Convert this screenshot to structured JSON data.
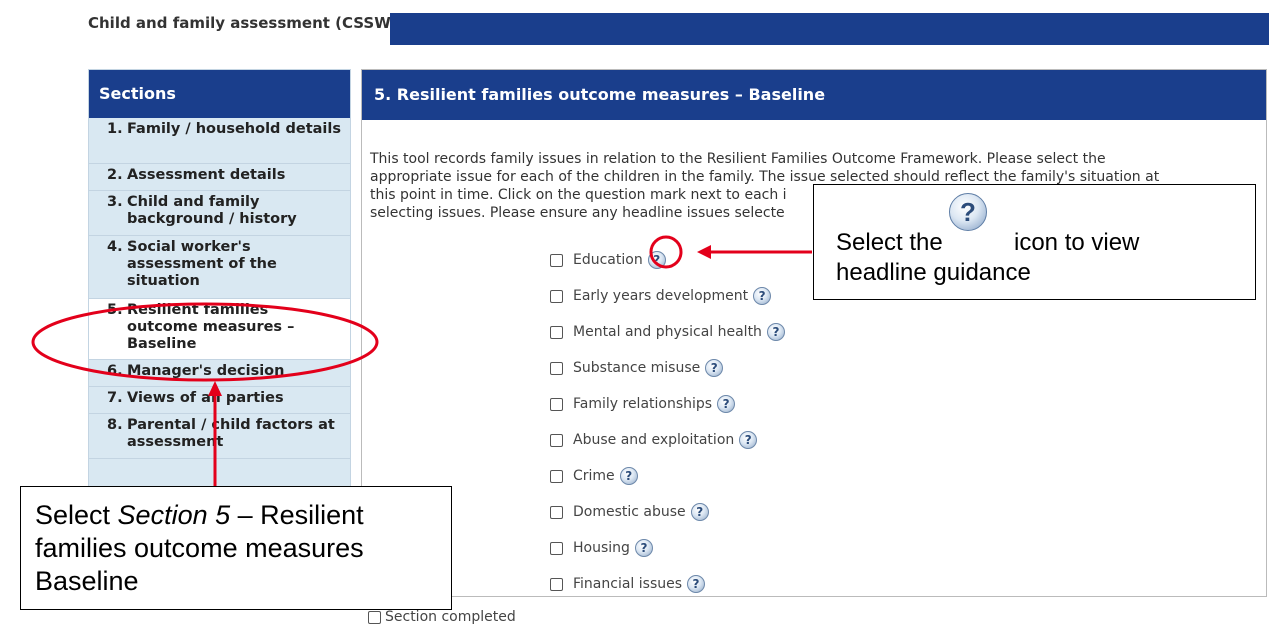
{
  "window": {
    "title": "Child and family assessment (CSSW)"
  },
  "sidebar": {
    "header": "Sections",
    "items": [
      {
        "num": "1.",
        "label": "Family / household details"
      },
      {
        "num": "2.",
        "label": "Assessment details"
      },
      {
        "num": "3.",
        "label": "Child and family background / history"
      },
      {
        "num": "4.",
        "label": "Social worker's assessment of the situation"
      },
      {
        "num": "5.",
        "label": "Resilient families outcome measures – Baseline"
      },
      {
        "num": "6.",
        "label": "Manager's decision"
      },
      {
        "num": "7.",
        "label": "Views of all parties"
      },
      {
        "num": "8.",
        "label": "Parental / child factors at assessment"
      }
    ],
    "active_index": 4
  },
  "main": {
    "header": "5. Resilient families outcome measures – Baseline",
    "intro_lines": [
      "This tool records family issues in relation to the Resilient Families Outcome Framework. Please select the",
      "appropriate issue for each of the children in the family. The issue selected should reflect the family's situation at",
      "this point in time. Click on the question mark next to each i",
      "selecting issues. Please ensure any headline issues selecte"
    ],
    "issues": [
      {
        "label": "Education"
      },
      {
        "label": "Early years development"
      },
      {
        "label": "Mental and physical health"
      },
      {
        "label": "Substance misuse"
      },
      {
        "label": "Family relationships"
      },
      {
        "label": "Abuse and exploitation"
      },
      {
        "label": "Crime"
      },
      {
        "label": "Domestic abuse"
      },
      {
        "label": "Housing"
      },
      {
        "label": "Financial issues"
      }
    ],
    "help_icon": "help-question-icon",
    "section_completed_label": "Section completed"
  },
  "callouts": {
    "icon_hint": {
      "prefix": "Select the",
      "suffix": "icon to view",
      "line2": "headline guidance"
    },
    "section_hint": {
      "prefix": "Select ",
      "emphasis": "Section 5",
      "rest": " – Resilient families outcome measures Baseline"
    }
  },
  "colors": {
    "header_blue": "#1a3e8c",
    "sidebar_bg": "#d9e8f2",
    "annotation_red": "#e3001b"
  }
}
